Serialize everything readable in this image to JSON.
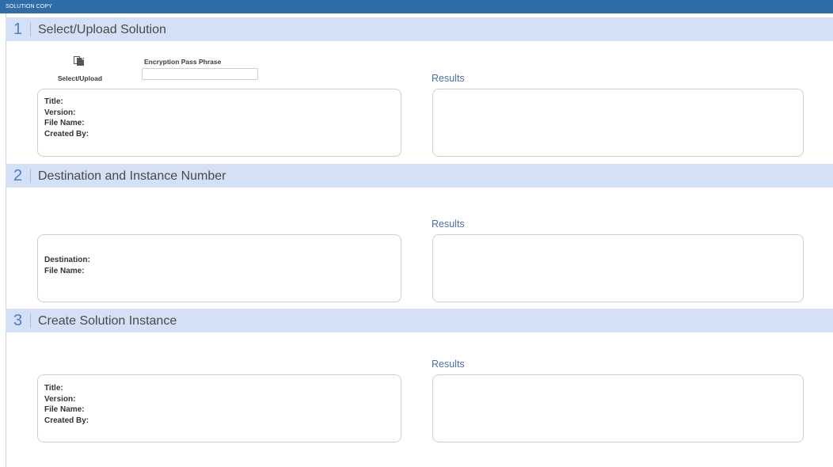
{
  "header": {
    "title": "SOLUTION COPY"
  },
  "sections": [
    {
      "number": "1",
      "title": "Select/Upload Solution",
      "upload_label": "Select/Upload",
      "passphrase_label": "Encryption Pass Phrase",
      "passphrase_value": "",
      "results_label": "Results",
      "info_fields": [
        "Title:",
        "Version:",
        "File Name:",
        "Created By:"
      ]
    },
    {
      "number": "2",
      "title": "Destination and Instance Number",
      "results_label": "Results",
      "info_fields": [
        "Destination:",
        "File Name:"
      ]
    },
    {
      "number": "3",
      "title": "Create Solution Instance",
      "results_label": "Results",
      "info_fields": [
        "Title:",
        "Version:",
        "File Name:",
        "Created By:"
      ]
    }
  ],
  "icons": {
    "upload": "upload-copy-icon"
  },
  "colors": {
    "topbar": "#2f6da8",
    "section_band": "#d3e0f5",
    "section_number": "#4f7dc0",
    "results_label": "#4a6fa5"
  }
}
